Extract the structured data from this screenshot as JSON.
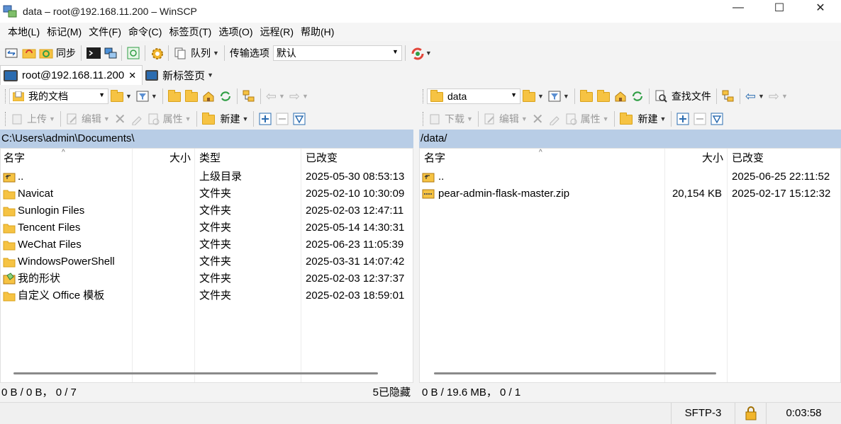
{
  "window": {
    "title": "data – root@192.168.11.200 – WinSCP",
    "minimize": "—",
    "maximize": "☐",
    "close": "✕"
  },
  "menu": [
    "本地(L)",
    "标记(M)",
    "文件(F)",
    "命令(C)",
    "标签页(T)",
    "选项(O)",
    "远程(R)",
    "帮助(H)"
  ],
  "toolbar": {
    "sync_label": "同步",
    "queue_label": "队列",
    "transfer_options_label": "传输选项",
    "transfer_preset": "默认"
  },
  "tabs": {
    "session_label": "root@192.168.11.200",
    "session_close": "✕",
    "new_tab_label": "新标签页"
  },
  "local": {
    "location": "我的文档",
    "path": "C:\\Users\\admin\\Documents\\",
    "upload_label": "上传",
    "edit_label": "编辑",
    "properties_label": "属性",
    "new_label": "新建",
    "columns": {
      "name": "名字",
      "size": "大小",
      "type": "类型",
      "changed": "已改变"
    },
    "rows": [
      {
        "name": "..",
        "size": "",
        "type": "上级目录",
        "changed": "2025-05-30 08:53:13",
        "icon": "parent-folder-icon"
      },
      {
        "name": "Navicat",
        "size": "",
        "type": "文件夹",
        "changed": "2025-02-10 10:30:09",
        "icon": "folder-icon"
      },
      {
        "name": "Sunlogin Files",
        "size": "",
        "type": "文件夹",
        "changed": "2025-02-03 12:47:11",
        "icon": "folder-icon"
      },
      {
        "name": "Tencent Files",
        "size": "",
        "type": "文件夹",
        "changed": "2025-05-14 14:30:31",
        "icon": "folder-icon"
      },
      {
        "name": "WeChat Files",
        "size": "",
        "type": "文件夹",
        "changed": "2025-06-23 11:05:39",
        "icon": "folder-icon"
      },
      {
        "name": "WindowsPowerShell",
        "size": "",
        "type": "文件夹",
        "changed": "2025-03-31 14:07:42",
        "icon": "folder-icon"
      },
      {
        "name": "我的形状",
        "size": "",
        "type": "文件夹",
        "changed": "2025-02-03 12:37:37",
        "icon": "shapes-folder-icon"
      },
      {
        "name": "自定义 Office 模板",
        "size": "",
        "type": "文件夹",
        "changed": "2025-02-03 18:59:01",
        "icon": "folder-icon"
      }
    ],
    "status_left": "0 B / 0 B，  0 / 7",
    "status_right": "5已隐藏"
  },
  "remote": {
    "location": "data",
    "path": "/data/",
    "download_label": "下载",
    "edit_label": "编辑",
    "properties_label": "属性",
    "new_label": "新建",
    "find_files_label": "查找文件",
    "columns": {
      "name": "名字",
      "size": "大小",
      "changed": "已改变"
    },
    "rows": [
      {
        "name": "..",
        "size": "",
        "changed": "2025-06-25 22:11:52",
        "icon": "parent-folder-icon"
      },
      {
        "name": "pear-admin-flask-master.zip",
        "size": "20,154 KB",
        "changed": "2025-02-17 15:12:32",
        "icon": "zip-file-icon"
      }
    ],
    "status_left": "0 B / 19.6 MB，  0 / 1"
  },
  "statusbar": {
    "protocol": "SFTP-3",
    "elapsed": "0:03:58"
  },
  "colors": {
    "path_bar": "#b8cde6",
    "folder": "#f6c343"
  }
}
